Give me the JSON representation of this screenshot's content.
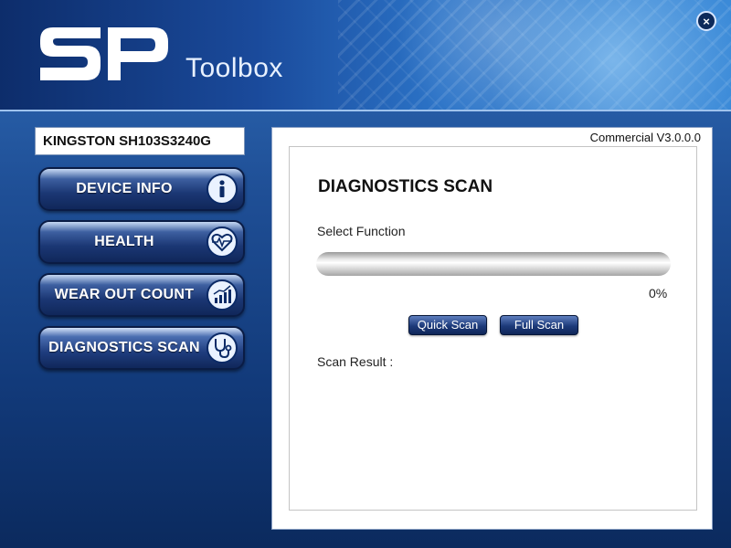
{
  "app": {
    "title": "Toolbox",
    "logo_text": "SP",
    "close_symbol": "×",
    "version": "Commercial V3.0.0.0"
  },
  "device": {
    "name": "KINGSTON SH103S3240G"
  },
  "nav": {
    "items": [
      {
        "label": "DEVICE INFO",
        "icon": "info-icon",
        "active": false
      },
      {
        "label": "HEALTH",
        "icon": "heart-pulse-icon",
        "active": false
      },
      {
        "label": "WEAR OUT COUNT",
        "icon": "chart-icon",
        "active": false
      },
      {
        "label": "DIAGNOSTICS SCAN",
        "icon": "stethoscope-icon",
        "active": true
      }
    ]
  },
  "main": {
    "heading": "DIAGNOSTICS SCAN",
    "select_function_label": "Select Function",
    "progress_value": 0,
    "progress_text": "0%",
    "quick_scan_label": "Quick Scan",
    "full_scan_label": "Full Scan",
    "scan_result_label": "Scan Result :"
  },
  "colors": {
    "brand_blue": "#1f4f96",
    "button_navy": "#10275a"
  }
}
